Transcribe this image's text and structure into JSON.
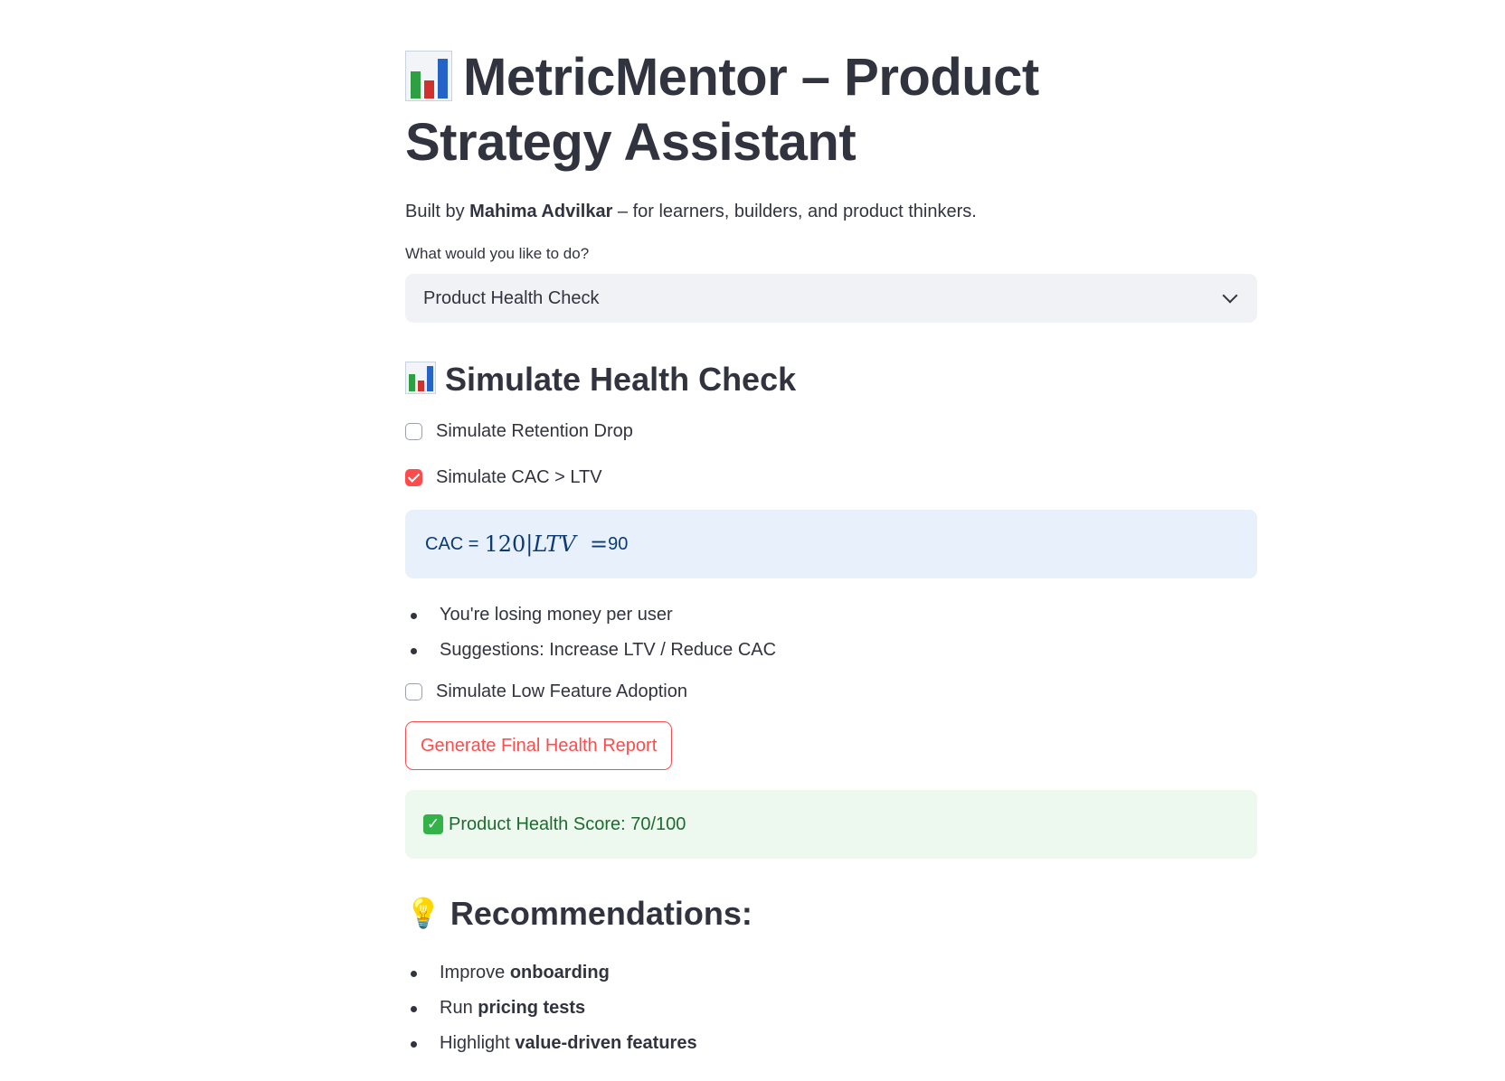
{
  "title": "MetricMentor – Product Strategy Assistant",
  "subtitle": {
    "prefix": "Built by ",
    "author": "Mahima Advilkar",
    "suffix": " – for learners, builders, and product thinkers."
  },
  "task_select": {
    "label": "What would you like to do?",
    "selected": "Product Health Check"
  },
  "health_section": {
    "heading": "Simulate Health Check",
    "checkboxes": [
      {
        "label": "Simulate Retention Drop",
        "checked": false
      },
      {
        "label": "Simulate CAC > LTV",
        "checked": true
      },
      {
        "label": "Simulate Low Feature Adoption",
        "checked": false
      }
    ],
    "cac_info": {
      "prefix": "CAC = ",
      "cac_value": "120",
      "separator": "|",
      "ltv_symbol": "LTV",
      "equals": "=",
      "ltv_value": "90"
    },
    "cac_bullets": [
      "You're losing money per user",
      "Suggestions: Increase LTV / Reduce CAC"
    ],
    "report_button": "Generate Final Health Report"
  },
  "score_message": "Product Health Score: 70/100",
  "recommendations": {
    "heading": "Recommendations:",
    "items": [
      {
        "prefix": "Improve ",
        "emphasis": "onboarding"
      },
      {
        "prefix": "Run ",
        "emphasis": "pricing tests"
      },
      {
        "prefix": "Highlight ",
        "emphasis": "value-driven features"
      }
    ]
  },
  "icons": {
    "title_icon": "bar-chart-icon",
    "section_icon": "bar-chart-icon",
    "select_icon": "chevron-down-icon",
    "score_icon": "check-mark-icon",
    "recommendations_icon": "light-bulb-icon"
  },
  "colors": {
    "accent": "#ff4b4b",
    "info_bg": "#e8f0fb",
    "info_text": "#0b3a74",
    "success_bg": "#edf8ee",
    "success_text": "#1e6b30",
    "text": "#31333f"
  }
}
